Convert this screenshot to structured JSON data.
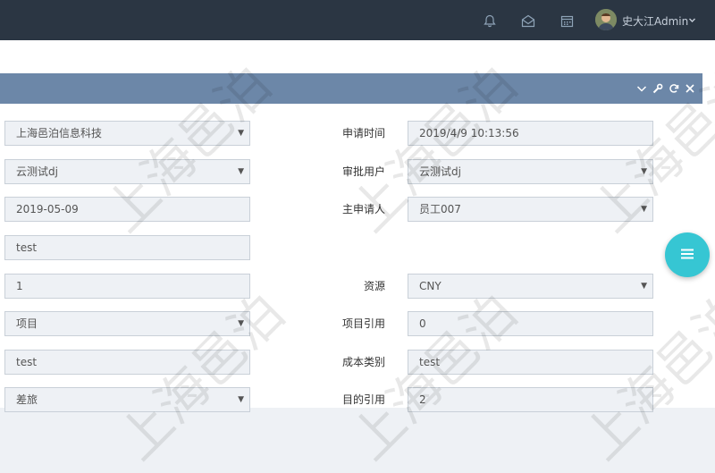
{
  "topbar": {
    "icons": [
      "bell-icon",
      "envelope-icon",
      "calendar-icon"
    ],
    "user_name": "史大江Admin"
  },
  "form": {
    "rows": [
      {
        "left_value": "上海邑泊信息科技",
        "left_is_select": true,
        "right_label": "申请时间",
        "right_value": "2019/4/9 10:13:56",
        "right_is_select": false
      },
      {
        "left_value": "云测试dj",
        "left_is_select": true,
        "right_label": "审批用户",
        "right_value": "云测试dj",
        "right_is_select": true
      },
      {
        "left_value": "2019-05-09",
        "left_is_select": false,
        "right_label": "主申请人",
        "right_value": "员工007",
        "right_is_select": true
      },
      {
        "left_value": "test",
        "left_is_select": false,
        "right_label": "",
        "right_value": null,
        "right_is_select": false
      },
      {
        "left_value": "1",
        "left_is_select": false,
        "right_label": "资源",
        "right_value": "CNY",
        "right_is_select": true
      },
      {
        "left_value": "项目",
        "left_is_select": true,
        "right_label": "项目引用",
        "right_value": "0",
        "right_is_select": false
      },
      {
        "left_value": "test",
        "left_is_select": false,
        "right_label": "成本类别",
        "right_value": "test",
        "right_is_select": false
      },
      {
        "left_value": "差旅",
        "left_is_select": true,
        "right_label": "目的引用",
        "right_value": "2",
        "right_is_select": false
      }
    ]
  },
  "watermark_text": "上海邑泊",
  "colors": {
    "topbar": "#2b3643",
    "portlet_header": "#6c87a8",
    "fab": "#36c6d3",
    "field_bg": "#eef1f5"
  }
}
